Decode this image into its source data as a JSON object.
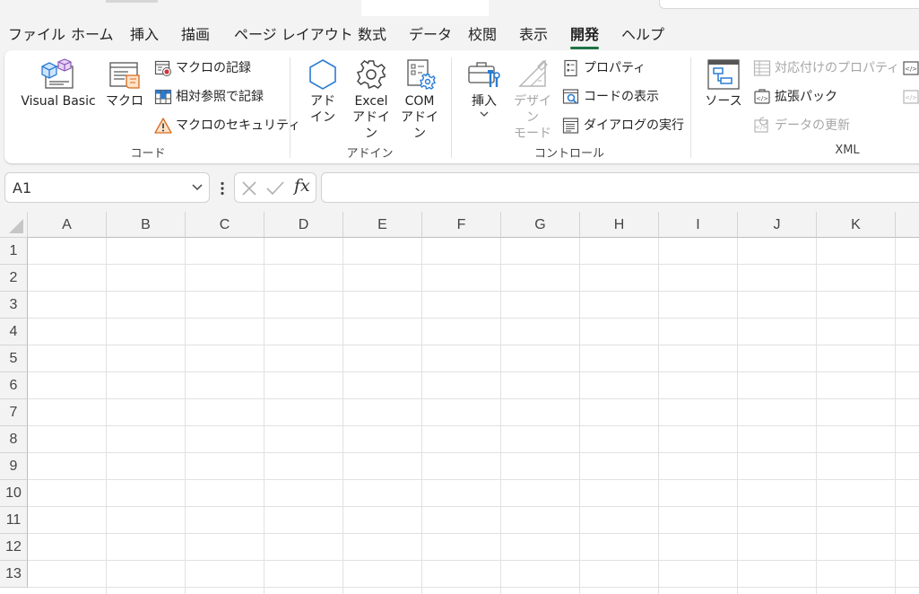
{
  "menu": {
    "tabs": [
      {
        "label": "ファイル",
        "active": false
      },
      {
        "label": "ホーム",
        "active": false
      },
      {
        "label": "挿入",
        "active": false
      },
      {
        "label": "描画",
        "active": false
      },
      {
        "label": "ページ レイアウト",
        "active": false
      },
      {
        "label": "数式",
        "active": false
      },
      {
        "label": "データ",
        "active": false
      },
      {
        "label": "校閲",
        "active": false
      },
      {
        "label": "表示",
        "active": false
      },
      {
        "label": "開発",
        "active": true
      },
      {
        "label": "ヘルプ",
        "active": false
      }
    ]
  },
  "ribbon": {
    "code": {
      "label": "コード",
      "visual_basic": "Visual Basic",
      "macros": "マクロ",
      "record_macro": "マクロの記録",
      "relative_ref": "相対参照で記録",
      "macro_security": "マクロのセキュリティ"
    },
    "addins": {
      "label": "アドイン",
      "addin_line1": "アド",
      "addin_line2": "イン",
      "excel_addin_line1": "Excel",
      "excel_addin_line2": "アドイン",
      "com_addin_line1": "COM",
      "com_addin_line2": "アドイン"
    },
    "controls": {
      "label": "コントロール",
      "insert": "挿入",
      "design_line1": "デザイン",
      "design_line2": "モード",
      "properties": "プロパティ",
      "view_code": "コードの表示",
      "run_dialog": "ダイアログの実行"
    },
    "xml": {
      "label": "XML",
      "source": "ソース",
      "map_properties": "対応付けのプロパティ",
      "expansion_packs": "拡張パック",
      "refresh_data": "データの更新"
    }
  },
  "formula_bar": {
    "name_box": "A1",
    "formula_value": ""
  },
  "sheet": {
    "columns": [
      "A",
      "B",
      "C",
      "D",
      "E",
      "F",
      "G",
      "H",
      "I",
      "J",
      "K"
    ],
    "rows": [
      "1",
      "2",
      "3",
      "4",
      "5",
      "6",
      "7",
      "8",
      "9",
      "10",
      "11",
      "12",
      "13"
    ]
  },
  "colors": {
    "accent": "#217346",
    "disabled": "#a6a6a6",
    "icon_blue": "#2b7cd3"
  }
}
